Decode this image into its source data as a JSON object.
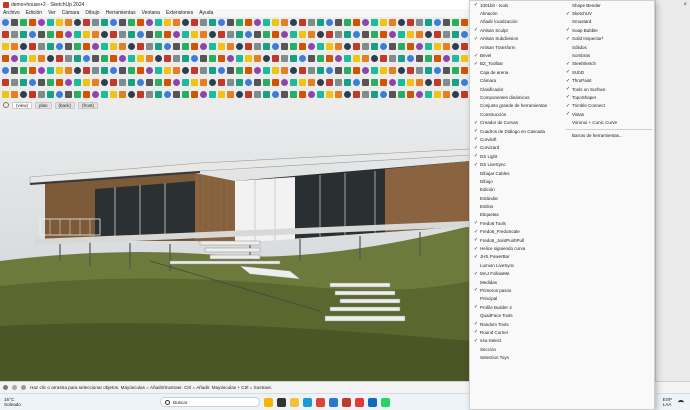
{
  "window": {
    "title": "demo+house+2 - SketchUp 2024"
  },
  "menubar": {
    "items": [
      "Archivo",
      "Edición",
      "Ver",
      "Cámara",
      "Dibujo",
      "Herramientas",
      "Ventana",
      "Extensiones",
      "Ayuda"
    ]
  },
  "view_tabs": [
    "(view)",
    "plan",
    "(back)",
    "(front)"
  ],
  "status": {
    "text": "Haz clic o arrastra para seleccionar objetos. Mayúsculas = Añadir/Sustraer. Ctrl = Añadir. Mayúsculas + Ctrl = Sustraer."
  },
  "taskbar": {
    "temp": "16°C",
    "condition": "Soleado",
    "search_placeholder": "Buscar",
    "lang": "ESP",
    "lang_sub": "LAA"
  },
  "menu": {
    "col1": [
      {
        "label": "1001bit - tools",
        "checked": true
      },
      {
        "label": "Almacén",
        "checked": false
      },
      {
        "label": "Añadir localización",
        "checked": false
      },
      {
        "label": "Artisan Sculpt",
        "checked": true
      },
      {
        "label": "Artisan Subdivision",
        "checked": true
      },
      {
        "label": "Artisan Transform",
        "checked": false
      },
      {
        "label": "Bevel",
        "checked": true
      },
      {
        "label": "BZ_Toolbar",
        "checked": true
      },
      {
        "label": "Caja de arena",
        "checked": false
      },
      {
        "label": "Cámara",
        "checked": false
      },
      {
        "label": "Clasificador",
        "checked": false
      },
      {
        "label": "Componentes dinámicos",
        "checked": false
      },
      {
        "label": "Conjunto grande de herramientas",
        "checked": false
      },
      {
        "label": "Construcción",
        "checked": false
      },
      {
        "label": "Creador de Curvas",
        "checked": true
      },
      {
        "label": "Cuadros de Diálogo en Cascada",
        "checked": true
      },
      {
        "label": "Curviloft",
        "checked": true
      },
      {
        "label": "Curvizard",
        "checked": true
      },
      {
        "label": "DS Light",
        "checked": true
      },
      {
        "label": "DS LiveSync",
        "checked": true
      },
      {
        "label": "Dibujar Cables",
        "checked": false
      },
      {
        "label": "Dibujo",
        "checked": false
      },
      {
        "label": "Edición",
        "checked": false
      },
      {
        "label": "Estándar",
        "checked": false
      },
      {
        "label": "Estilos",
        "checked": false
      },
      {
        "label": "Etiquetas",
        "checked": false
      },
      {
        "label": "Fredo6 Tools",
        "checked": true
      },
      {
        "label": "Fredo6_FredoScale",
        "checked": true
      },
      {
        "label": "Fredo6_JointPushPull",
        "checked": true
      },
      {
        "label": "Helice siguiendo curva",
        "checked": true
      },
      {
        "label": "JHS PowerBar",
        "checked": true
      },
      {
        "label": "Lumion LiveSync",
        "checked": false
      },
      {
        "label": "MAJ FollowMe",
        "checked": true
      },
      {
        "label": "Medidas",
        "checked": false
      },
      {
        "label": "Primeros pasos",
        "checked": true
      },
      {
        "label": "Principal",
        "checked": false
      },
      {
        "label": "Profile Builder 4",
        "checked": true
      },
      {
        "label": "QuadFace Tools",
        "checked": false
      },
      {
        "label": "Random Tools",
        "checked": true
      },
      {
        "label": "Round Corner",
        "checked": true
      },
      {
        "label": "s4u-Select",
        "checked": true
      },
      {
        "label": "Sección",
        "checked": false
      },
      {
        "label": "Selection Toys",
        "checked": false
      }
    ],
    "col2": [
      {
        "label": "Shape Bender",
        "checked": false
      },
      {
        "label": "SketchUV",
        "checked": true
      },
      {
        "label": "Smustard",
        "checked": false
      },
      {
        "label": "Soap Bubble",
        "checked": true
      },
      {
        "label": "Solid Inspector²",
        "checked": true
      },
      {
        "label": "Sólidos",
        "checked": false
      },
      {
        "label": "Sombras",
        "checked": false
      },
      {
        "label": "SteelSketch",
        "checked": true
      },
      {
        "label": "SUbD",
        "checked": true
      },
      {
        "label": "ThruPaint",
        "checked": true
      },
      {
        "label": "Tools on Surface",
        "checked": true
      },
      {
        "label": "TopoShaper",
        "checked": true
      },
      {
        "label": "Trimble Connect",
        "checked": true
      },
      {
        "label": "Vistas",
        "checked": true
      },
      {
        "label": "Voronoi + Conic Curve",
        "checked": false
      },
      {
        "label": "Barras de herramientas...",
        "checked": false
      }
    ]
  },
  "colors": {
    "menu_bg": "#f9f9f9",
    "toolbar_bg": "#ececec",
    "wood": "#8a6440",
    "grass": "#55622e"
  }
}
